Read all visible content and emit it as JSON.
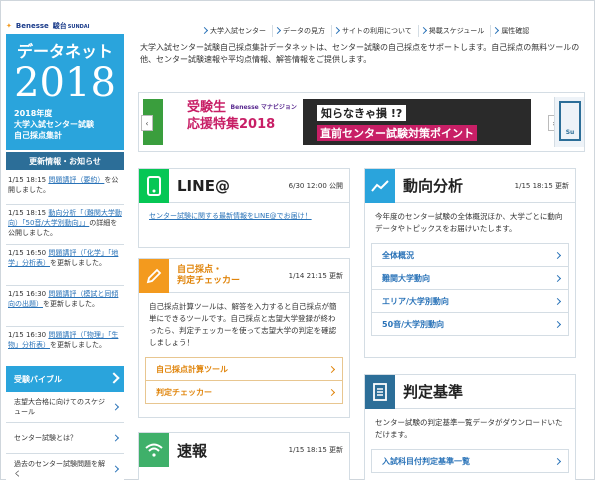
{
  "logos": {
    "benesse": "Benesse",
    "sundai": "駿台",
    "sundai_en": "SUNDAI"
  },
  "hero": {
    "title": "データネット",
    "year": "2018",
    "sub1": "2018年度",
    "sub2": "大学入試センター試験",
    "sub3": "自己採点集計"
  },
  "top_nav": [
    "大学入試センター",
    "データの見方",
    "サイトの利用について",
    "掲載スケジュール",
    "属性確認"
  ],
  "intro": "大学入試センター試験自己採点集計データネットは、センター試験の自己採点をサポートします。自己採点の無料ツールの他、センター試験速報や平均点情報、解答情報をご提供します。",
  "banner": {
    "pink_line1": "受験生",
    "brand": "Benesse マナビジョン",
    "pink_line2": "応援特集2018",
    "dark_line1": "知らなきゃ損 !?",
    "dark_line2": "直前センター試験対策ポイント",
    "side_label": "Su"
  },
  "news": {
    "heading": "更新情報・お知らせ",
    "items": [
      {
        "time": "1/15 18:15",
        "link": "問題講評（要約）",
        "rest": "を公開しました。"
      },
      {
        "time": "1/15 18:15",
        "link": "動向分析「（難関大学動向）「50音/大学別動向」」",
        "rest": "の詳細を公開しました。"
      },
      {
        "time": "1/15 16:50",
        "link": "問題講評（「化学」「地学」分析表）",
        "rest": "を更新しました。"
      },
      {
        "time": "1/15 16:30",
        "link": "問題講評（模試と同傾向の出題）",
        "rest": "を更新しました。"
      },
      {
        "time": "1/15 16:30",
        "link": "問題講評（「物理」「生物」分析表）",
        "rest": "を更新しました。"
      }
    ]
  },
  "bible": {
    "heading": "受験バイブル",
    "items": [
      "志望大合格に向けてのスケジュール",
      "センター試験とは？",
      "過去のセンター試験問題を解く"
    ]
  },
  "line_card": {
    "title": "LINE@",
    "time": "6/30 12:00 公開",
    "body": "センター試験に関する最新情報をLINE@でお届け！"
  },
  "self_card": {
    "title1": "自己採点・",
    "title2": "判定チェッカー",
    "time": "1/14 21:15 更新",
    "body": "自己採点計算ツールは、解答を入力すると自己採点が簡単にできるツールです。自己採点と志望大学登録が終わったら、判定チェッカーを使って志望大学の判定を確認しましょう！",
    "links": [
      "自己採点計算ツール",
      "判定チェッカー"
    ]
  },
  "sokuho_card": {
    "title": "速報",
    "time": "1/15 18:15 更新"
  },
  "trend_card": {
    "title": "動向分析",
    "time": "1/15 18:15 更新",
    "body": "今年度のセンター試験の全体概況ほか、大学ごとに動向データやトピックスをお届けいたします。",
    "links": [
      "全体概況",
      "難関大学動向",
      "エリア/大学別動向",
      "50音/大学別動向"
    ]
  },
  "judge_card": {
    "title": "判定基準",
    "body": "センター試験の判定基準一覧データがダウンロードいただけます。",
    "links": [
      "入試科目付判定基準一覧"
    ]
  },
  "colors": {
    "primary": "#2aa4dc",
    "dark": "#2c6e98",
    "line_green": "#06c755",
    "orange": "#f39a1e",
    "link": "#2a73b8"
  }
}
